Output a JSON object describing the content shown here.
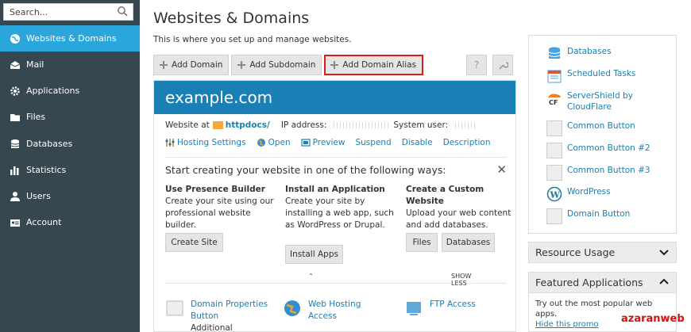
{
  "search": {
    "placeholder": "Search..."
  },
  "sidebar": {
    "items": [
      {
        "label": "Websites & Domains",
        "icon": "globe-icon",
        "active": true
      },
      {
        "label": "Mail",
        "icon": "mail-icon"
      },
      {
        "label": "Applications",
        "icon": "gear-icon"
      },
      {
        "label": "Files",
        "icon": "folder-icon"
      },
      {
        "label": "Databases",
        "icon": "database-icon"
      },
      {
        "label": "Statistics",
        "icon": "bar-chart-icon"
      },
      {
        "label": "Users",
        "icon": "user-icon"
      },
      {
        "label": "Account",
        "icon": "id-card-icon"
      }
    ]
  },
  "page": {
    "title": "Websites & Domains",
    "description": "This is where you set up and manage websites."
  },
  "toolbar": {
    "add_domain": "Add Domain",
    "add_subdomain": "Add Subdomain",
    "add_domain_alias": "Add Domain Alias",
    "help_icon": "?"
  },
  "domain": {
    "name": "example.com",
    "website_at_label": "Website at",
    "docroot": "httpdocs/",
    "ip_label": "IP address:",
    "user_label": "System user:",
    "actions": [
      "Hosting Settings",
      "Open",
      "Preview",
      "Suspend",
      "Disable",
      "Description"
    ]
  },
  "start": {
    "title": "Start creating your website in one of the following ways:",
    "columns": [
      {
        "title": "Use Presence Builder",
        "desc": "Create your site using our professional website builder.",
        "buttons": [
          "Create Site"
        ]
      },
      {
        "title": "Install an Application",
        "desc": "Create your site by installing a web app, such as WordPress or Drupal.",
        "buttons": [
          "Install Apps"
        ]
      },
      {
        "title": "Create a Custom Website",
        "desc": "Upload your web content and add databases.",
        "buttons": [
          "Files",
          "Databases"
        ]
      }
    ],
    "show_less": "SHOW LESS"
  },
  "bottom_links": [
    {
      "label": "Domain Properties Button",
      "sub": "Additional comment"
    },
    {
      "label": "Web Hosting Access"
    },
    {
      "label": "FTP Access"
    }
  ],
  "right_panel": {
    "items": [
      {
        "label": "Databases",
        "icon": "database-icon"
      },
      {
        "label": "Scheduled Tasks",
        "icon": "calendar-icon"
      },
      {
        "label": "ServerShield by CloudFlare",
        "icon": "cloudflare-icon"
      },
      {
        "label": "Common Button",
        "icon": "button-icon"
      },
      {
        "label": "Common Button #2",
        "icon": "button-icon"
      },
      {
        "label": "Common Button #3",
        "icon": "button-icon"
      },
      {
        "label": "WordPress",
        "icon": "wordpress-icon"
      },
      {
        "label": "Domain Button",
        "icon": "button-icon"
      }
    ]
  },
  "resource_usage": {
    "label": "Resource Usage"
  },
  "featured": {
    "label": "Featured Applications",
    "desc": "Try out the most popular web apps.",
    "promo_link": "Hide this promo"
  },
  "watermark": "azaranweb"
}
